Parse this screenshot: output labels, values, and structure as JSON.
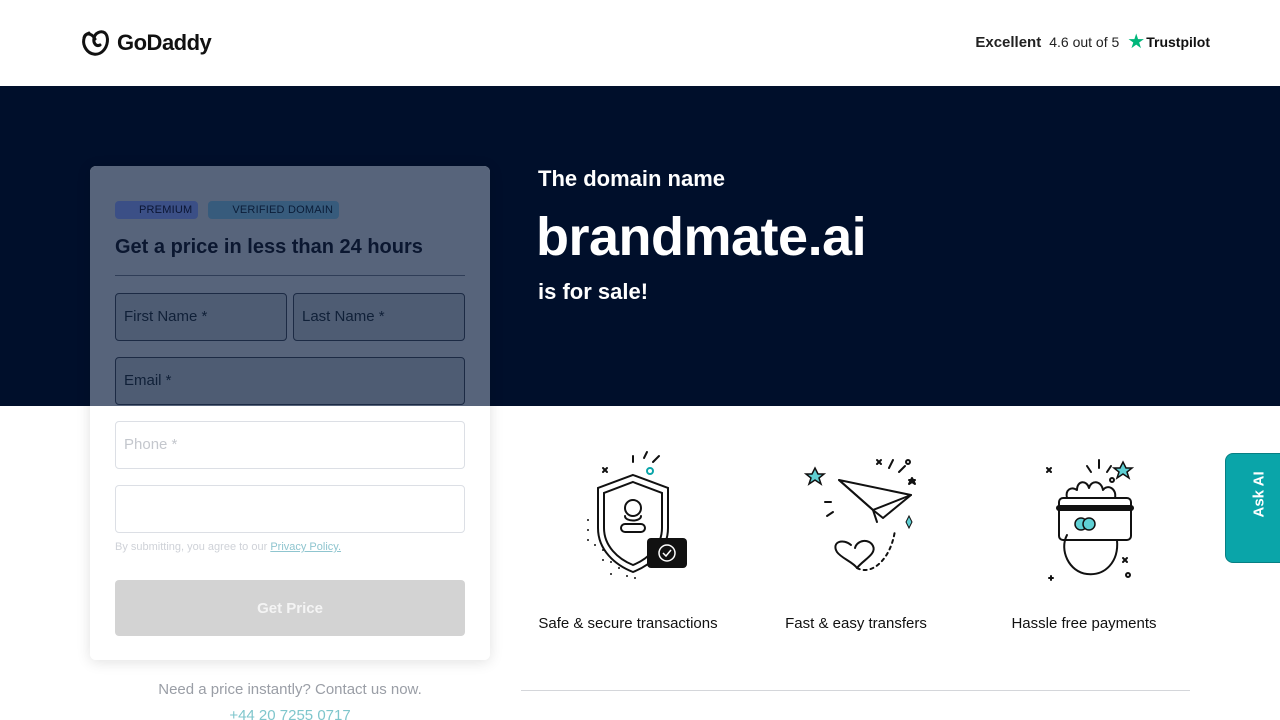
{
  "header": {
    "logo_text": "GoDaddy",
    "trust_rating_word": "Excellent",
    "trust_score": "4.6 out of 5",
    "trust_brand": "Trustpilot",
    "trust_star_color": "#00b67a"
  },
  "hero": {
    "pre": "The domain name",
    "domain": "brandmate.ai",
    "post": "is for sale!",
    "background": "#000f2b"
  },
  "form": {
    "badges": [
      "PREMIUM",
      "VERIFIED DOMAIN"
    ],
    "title": "Get a price in less than 24 hours",
    "first_name_placeholder": "First Name *",
    "last_name_placeholder": "Last Name *",
    "email_placeholder": "Email *",
    "phone_placeholder": "Phone *",
    "extra_value": "",
    "consent_text": "By submitting, you agree to our",
    "consent_link": "Privacy Policy.",
    "submit_label": "Get Price",
    "contact_text": "Need a price instantly? Contact us now.",
    "contact_phone": "+44 20 7255 0717"
  },
  "features": [
    {
      "label": "Safe & secure transactions",
      "icon": "shield-icon"
    },
    {
      "label": "Fast & easy transfers",
      "icon": "paper-plane-icon"
    },
    {
      "label": "Hassle free payments",
      "icon": "card-hand-icon"
    }
  ],
  "ask_ai": {
    "label": "Ask AI",
    "color": "#0aa5a9"
  }
}
